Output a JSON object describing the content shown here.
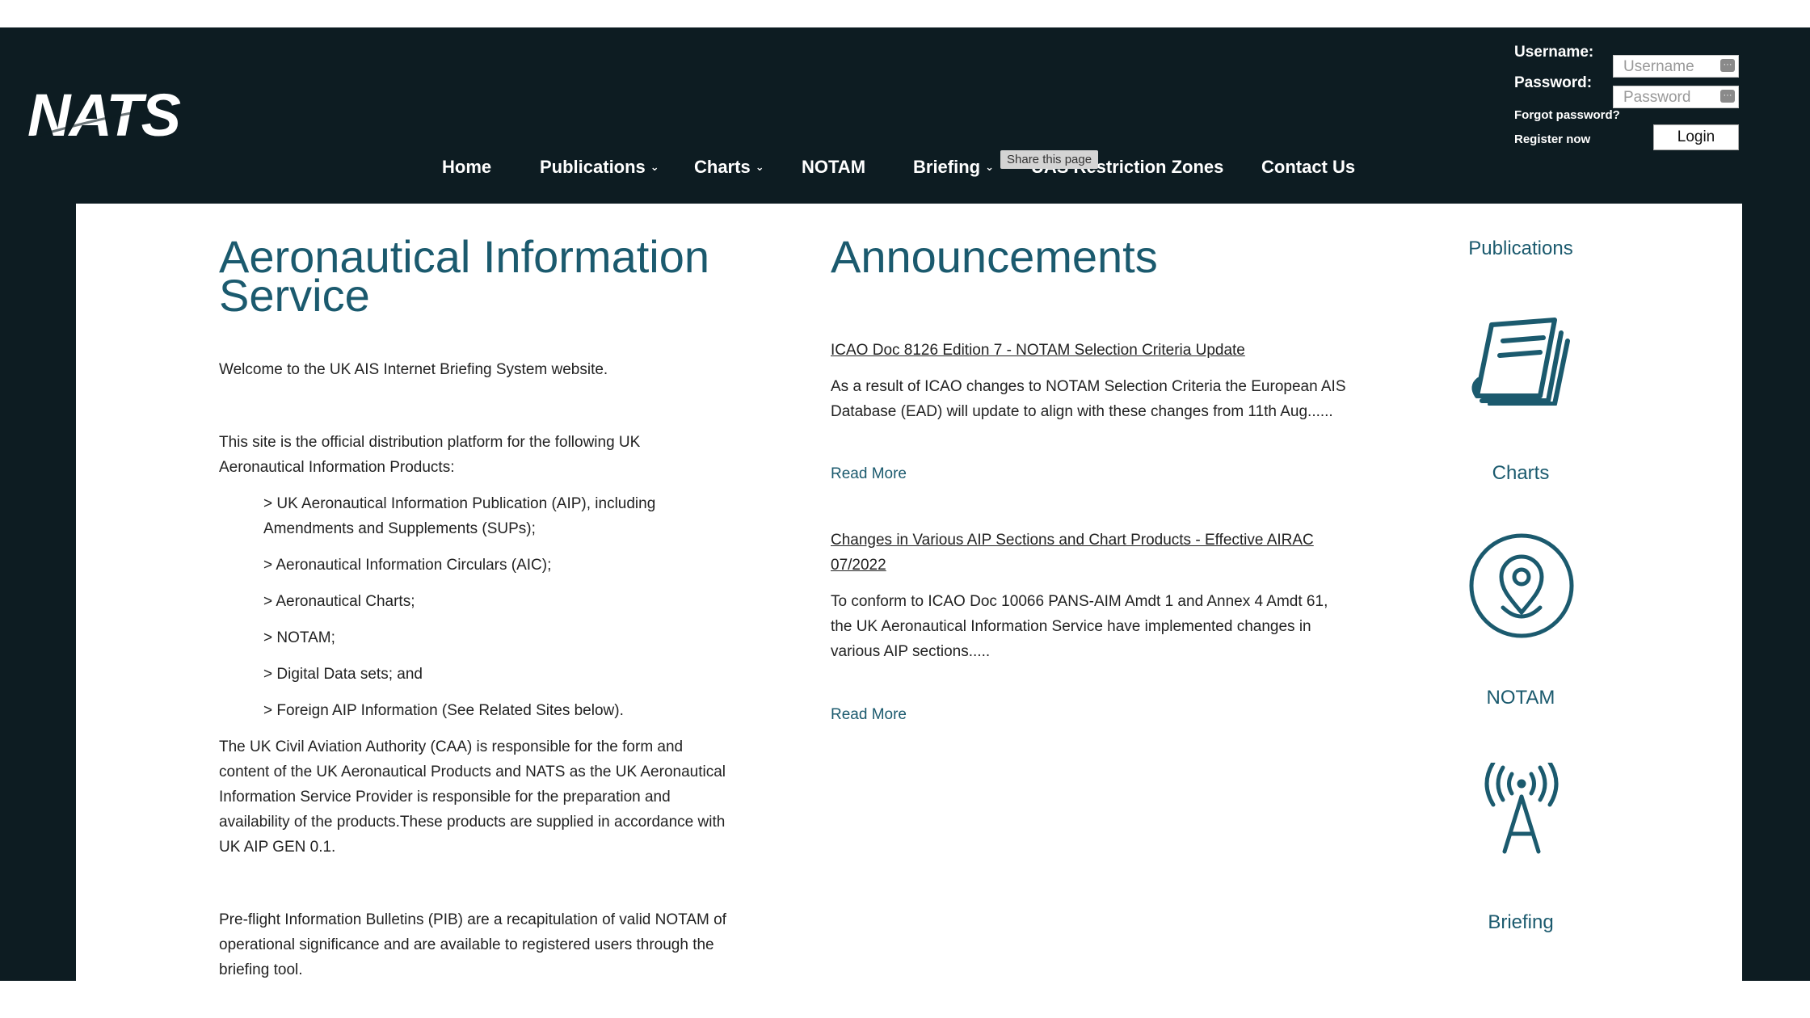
{
  "brand": {
    "logo_text": "NATS"
  },
  "login": {
    "username_label": "Username:",
    "password_label": "Password:",
    "username_placeholder": "Username",
    "password_placeholder": "Password",
    "forgot_link": "Forgot password?",
    "register_link": "Register now",
    "login_button": "Login"
  },
  "nav": {
    "items": [
      {
        "label": "Home",
        "dropdown": false
      },
      {
        "label": "Publications",
        "dropdown": true
      },
      {
        "label": "Charts",
        "dropdown": true
      },
      {
        "label": "NOTAM",
        "dropdown": false
      },
      {
        "label": "Briefing",
        "dropdown": true
      },
      {
        "label": "UAS Restriction Zones",
        "dropdown": false
      },
      {
        "label": "Contact Us",
        "dropdown": false
      }
    ],
    "tooltip": "Share this page"
  },
  "intro": {
    "title_line1": "Aeronautical Information",
    "title_line2": "Service",
    "welcome": "Welcome to the UK AIS Internet Briefing System website.",
    "platform_line1": "This site is the official distribution platform for the following UK",
    "platform_line2": "Aeronautical Information Products:",
    "products": [
      "> UK Aeronautical Information Publication (AIP), including",
      "Amendments and Supplements (SUPs);",
      "> Aeronautical Information Circulars (AIC);",
      "> Aeronautical Charts;",
      "> NOTAM;",
      "> Digital Data sets; and",
      "> Foreign AIP Information (See Related Sites below)."
    ],
    "caa_lines": [
      "The UK Civil Aviation Authority (CAA) is responsible for the form and",
      "content of the UK Aeronautical Products and NATS as the UK Aeronautical",
      "Information Service Provider is responsible for the preparation and",
      "availability of the products.These products are supplied in accordance with",
      "UK AIP GEN 0.1."
    ],
    "pib_lines": [
      "Pre-flight Information Bulletins (PIB) are a recapitulation of valid NOTAM of",
      "operational significance and are available to registered users through the",
      "briefing tool."
    ]
  },
  "announcements": {
    "title": "Announcements",
    "items": [
      {
        "headline_lines": [
          "ICAO Doc 8126 Edition 7 - NOTAM Selection Criteria Update"
        ],
        "body_lines": [
          "As a result of ICAO changes to NOTAM Selection Criteria the European AIS",
          "Database (EAD) will update to align with these changes from 11th Aug......"
        ],
        "read_more": "Read More"
      },
      {
        "headline_lines": [
          "Changes in Various AIP Sections and Chart Products - Effective AIRAC",
          "07/2022"
        ],
        "body_lines": [
          "To conform to ICAO Doc 10066 PANS-AIM Amdt 1 and Annex 4 Amdt 61,",
          "the UK Aeronautical Information Service have implemented changes in",
          "various AIP sections....."
        ],
        "read_more": "Read More"
      }
    ]
  },
  "sidebar": {
    "items": [
      {
        "label": "Publications",
        "icon": "book-stack-icon"
      },
      {
        "label": "Charts",
        "icon": "map-pin-icon"
      },
      {
        "label": "NOTAM",
        "icon": "radio-tower-icon"
      },
      {
        "label": "Briefing",
        "icon": "briefcase-icon"
      }
    ]
  },
  "colors": {
    "accent": "#1b5a6e",
    "header_bg": "#0d1c22"
  }
}
